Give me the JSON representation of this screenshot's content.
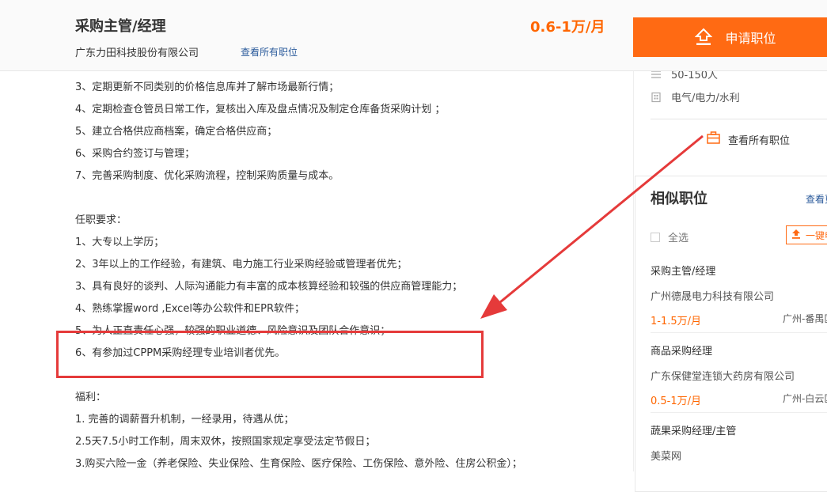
{
  "header": {
    "job_title": "采购主管/经理",
    "company": "广东力田科技股份有限公司",
    "view_all": "查看所有职位",
    "salary": "0.6-1万/月",
    "apply_label": "申请职位"
  },
  "description": {
    "duty_lines": [
      "3、定期更新不同类别的价格信息库并了解市场最新行情；",
      "4、定期检查仓管员日常工作，复核出入库及盘点情况及制定仓库备货采购计划 ；",
      "5、建立合格供应商档案，确定合格供应商；",
      "6、采购合约签订与管理；",
      "7、完善采购制度、优化采购流程，控制采购质量与成本。"
    ],
    "requirements_heading": "任职要求：",
    "requirement_lines": [
      "1、大专以上学历；",
      "2、3年以上的工作经验，有建筑、电力施工行业采购经验或管理者优先；",
      "3、具有良好的谈判、人际沟通能力有丰富的成本核算经验和较强的供应商管理能力；",
      "4、熟练掌握word ,Excel等办公软件和EPR软件；",
      "5、为人正直责任心强，较强的职业道德、风险意识及团队合作意识；",
      "6、有参加过CPPM采购经理专业培训者优先。"
    ],
    "benefits_heading": "福利：",
    "benefit_lines": [
      "1. 完善的调薪晋升机制，一经录用，待遇从优；",
      "2.5天7.5小时工作制，周末双休，按照国家规定享受法定节假日；",
      "3.购买六险一金（养老保险、失业保险、生育保险、医疗保险、工伤保险、意外险、住房公积金）；"
    ]
  },
  "company_info": {
    "size": "50-150人",
    "industry": "电气/电力/水利",
    "view_all": "查看所有职位"
  },
  "similar": {
    "title": "相似职位",
    "more": "查看更多",
    "select_all": "全选",
    "one_click": "一键申请",
    "jobs": [
      {
        "title": "采购主管/经理",
        "company": "广州德晟电力科技有限公司",
        "salary": "1-1.5万/月",
        "location": "广州-番禺区"
      },
      {
        "title": "商品采购经理",
        "company": "广东保健堂连锁大药房有限公司",
        "salary": "0.5-1万/月",
        "location": "广州-白云区"
      },
      {
        "title": "蔬果采购经理/主管",
        "company": "美菜网"
      }
    ]
  },
  "colors": {
    "accent": "#ff6a13",
    "salary": "#ff6600",
    "annotation": "#e53a3a",
    "link": "#2a5a9b"
  }
}
